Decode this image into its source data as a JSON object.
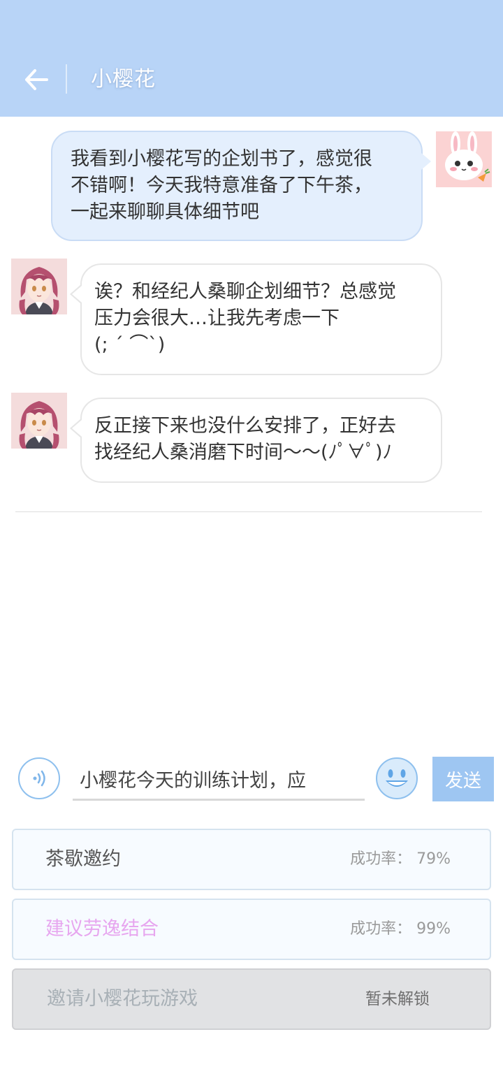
{
  "header": {
    "title": "小樱花",
    "background": "#b8d4f7"
  },
  "messages": [
    {
      "side": "right",
      "lines": [
        "我看到小樱花写的企划书了，感觉很",
        "不错啊！今天我特意准备了下午茶，",
        "一起来聊聊具体细节吧"
      ],
      "avatar": "bunny-avatar"
    },
    {
      "side": "left",
      "lines": [
        "诶？和经纪人桑聊企划细节？总感觉",
        "压力会很大…让我先考虑一下",
        "(; ´ ⌒`)"
      ],
      "avatar": "sakura-avatar"
    },
    {
      "side": "left",
      "lines": [
        "反正接下来也没什么安排了，正好去",
        "找经纪人桑消磨下时间～～(ﾉﾟ∀ﾟ)ﾉ"
      ],
      "avatar": "sakura-avatar"
    }
  ],
  "input": {
    "value": "小樱花今天的训练计划，应",
    "send_label": "发送"
  },
  "options": [
    {
      "label": "茶歇邀约",
      "rate": "成功率： 79%",
      "label_color": "#555555"
    },
    {
      "label": "建议劳逸结合",
      "rate": "成功率： 99%",
      "label_color": "#e7a6ef"
    },
    {
      "label": "邀请小樱花玩游戏",
      "rate": "暂未解锁",
      "label_color": "#a8b0b6"
    }
  ],
  "colors": {
    "accent": "#9ec6f2",
    "bubble_self": "#e4effd"
  }
}
